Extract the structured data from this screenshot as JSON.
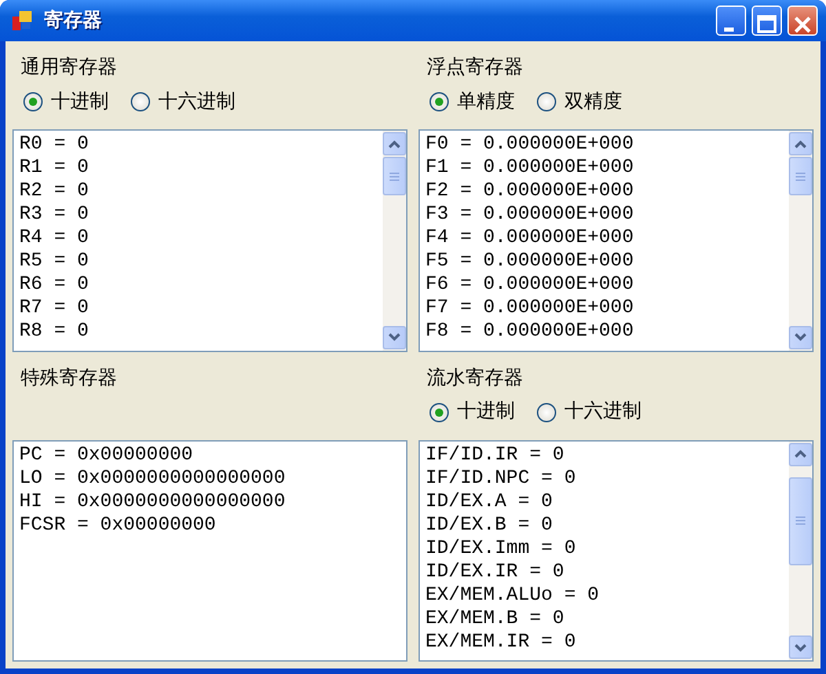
{
  "window": {
    "title": "寄存器"
  },
  "panels": [
    {
      "title": "通用寄存器",
      "radios": [
        {
          "label": "十进制",
          "selected": true
        },
        {
          "label": "十六进制",
          "selected": false
        }
      ],
      "scrollbar": true,
      "lines": [
        "R0 = 0",
        "R1 = 0",
        "R2 = 0",
        "R3 = 0",
        "R4 = 0",
        "R5 = 0",
        "R6 = 0",
        "R7 = 0",
        "R8 = 0"
      ]
    },
    {
      "title": "浮点寄存器",
      "radios": [
        {
          "label": "单精度",
          "selected": true
        },
        {
          "label": "双精度",
          "selected": false
        }
      ],
      "scrollbar": true,
      "lines": [
        "F0 = 0.000000E+000",
        "F1 = 0.000000E+000",
        "F2 = 0.000000E+000",
        "F3 = 0.000000E+000",
        "F4 = 0.000000E+000",
        "F5 = 0.000000E+000",
        "F6 = 0.000000E+000",
        "F7 = 0.000000E+000",
        "F8 = 0.000000E+000"
      ]
    },
    {
      "title": "特殊寄存器",
      "scrollbar": false,
      "lines": [
        "PC = 0x00000000",
        "LO = 0x0000000000000000",
        "HI = 0x0000000000000000",
        "FCSR = 0x00000000"
      ]
    },
    {
      "title": "流水寄存器",
      "radios": [
        {
          "label": "十进制",
          "selected": true
        },
        {
          "label": "十六进制",
          "selected": false
        }
      ],
      "scrollbar": true,
      "lines": [
        "IF/ID.IR = 0",
        "IF/ID.NPC = 0",
        "ID/EX.A = 0",
        "ID/EX.B = 0",
        "ID/EX.Imm = 0",
        "ID/EX.IR = 0",
        "EX/MEM.ALUo = 0",
        "EX/MEM.B = 0",
        "EX/MEM.IR = 0"
      ]
    }
  ]
}
